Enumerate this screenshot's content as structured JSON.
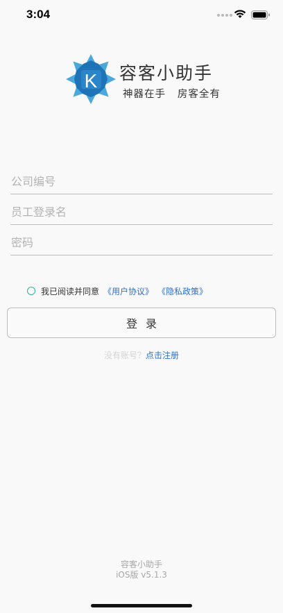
{
  "status_bar": {
    "time": "3:04"
  },
  "brand": {
    "title": "容客小助手",
    "slogan": "神器在手   房客全有",
    "logo_letter": "K",
    "logo_colors": [
      "#4aa8dc",
      "#1f74b8"
    ]
  },
  "form": {
    "company_placeholder": "公司编号",
    "username_placeholder": "员工登录名",
    "password_placeholder": "密码"
  },
  "agreement": {
    "text": "我已阅读并同意",
    "user_agreement": "《用户协议》",
    "privacy_policy": "《隐私政策》"
  },
  "login_button": "登录",
  "register": {
    "hint": "没有账号？",
    "link": "点击注册"
  },
  "footer": {
    "app_name": "容客小助手",
    "version": "iOS版 v5.1.3"
  },
  "colors": {
    "accent": "#2f6fc9",
    "check": "#2bb39a"
  }
}
